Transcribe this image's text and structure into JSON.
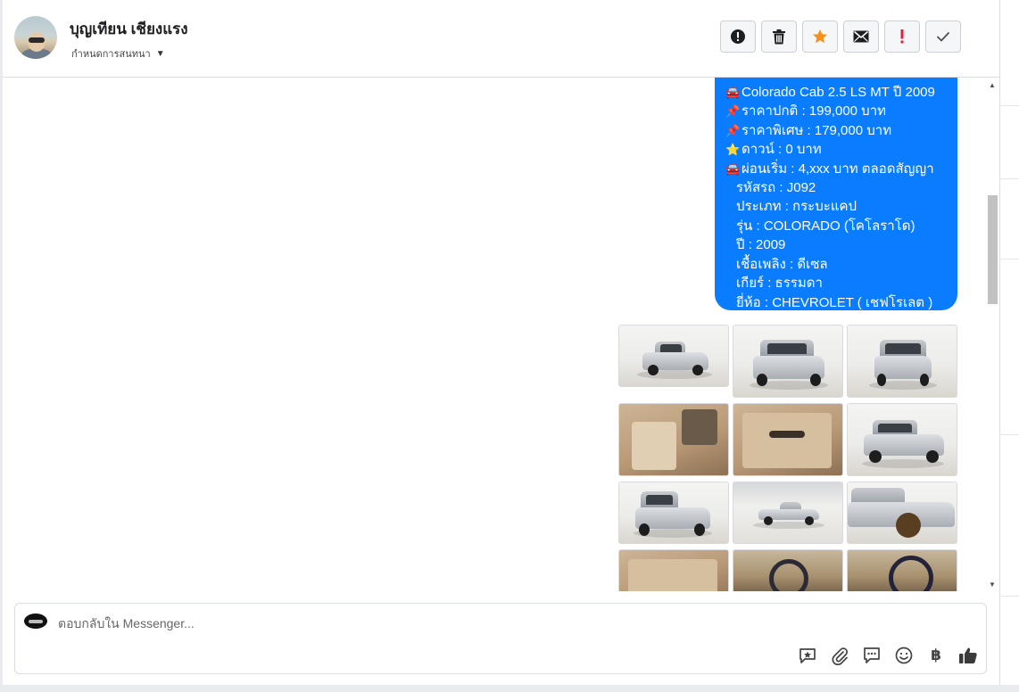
{
  "header": {
    "contact_name": "บุญเทียน เชียงแรง",
    "assign_label": "กำหนดการสนทนา",
    "actions": [
      "mark-spam",
      "delete",
      "star",
      "mark-unread",
      "follow-up",
      "done"
    ]
  },
  "message": {
    "lines": [
      {
        "icon": "🚘",
        "text": "Colorado Cab 2.5 LS MT ปี 2009"
      },
      {
        "icon": "📌",
        "text": "ราคาปกติ : 199,000 บาท"
      },
      {
        "icon": "📌",
        "text": "ราคาพิเศษ : 179,000 บาท"
      },
      {
        "icon": "⭐",
        "text": "ดาวน์ : 0 บาท"
      },
      {
        "icon": "🚘",
        "text": "ผ่อนเริ่ม : 4,xxx บาท ตลอดสัญญา"
      },
      {
        "icon": "",
        "text": "รหัสรถ : J092"
      },
      {
        "icon": "",
        "text": "ประเภท : กระบะแคป"
      },
      {
        "icon": "",
        "text": "รุ่น : COLORADO (โคโลราโด)"
      },
      {
        "icon": "",
        "text": "ปี : 2009"
      },
      {
        "icon": "",
        "text": "เชื้อเพลิง : ดีเซล"
      },
      {
        "icon": "",
        "text": "เกียร์ : ธรรมดา"
      },
      {
        "icon": "",
        "text": "ยี่ห้อ : CHEVROLET ( เชฟโรเลต )"
      }
    ],
    "bubble_color": "#0a7cff"
  },
  "composer": {
    "placeholder": "ตอบกลับใน Messenger...",
    "currency_symbol": "฿",
    "tools": [
      "saved-reply-icon",
      "attachment-icon",
      "chat-icon",
      "emoji-icon",
      "baht-icon",
      "like-icon"
    ]
  }
}
